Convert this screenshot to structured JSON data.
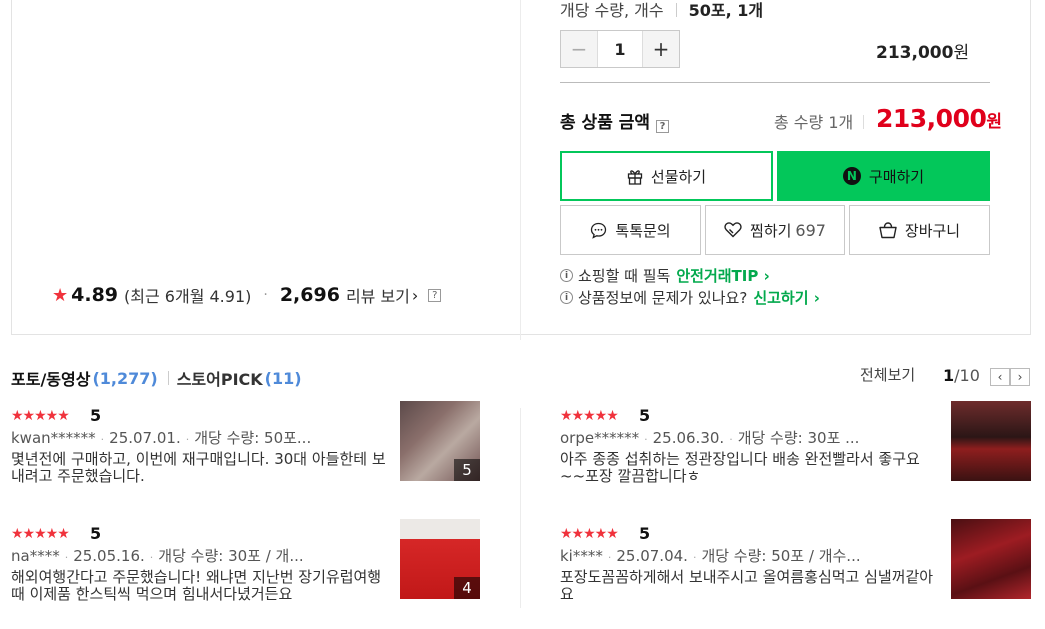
{
  "product_summary": {
    "rating_score": "4.89",
    "rating_recent": "(최근 6개월 4.91)",
    "review_count": "2,696",
    "review_link_label": "리뷰 보기"
  },
  "option": {
    "label": "개당 수량, 개수",
    "value": "50포, 1개",
    "quantity": "1",
    "line_price": "213,000",
    "currency": "원"
  },
  "total": {
    "label": "총 상품 금액",
    "qty_text": "총 수량 1개",
    "price": "213,000",
    "currency": "원"
  },
  "buttons": {
    "gift": "선물하기",
    "buy": "구매하기",
    "npay_mark": "N",
    "talk": "톡톡문의",
    "wish": "찜하기",
    "wish_count": "697",
    "cart": "장바구니"
  },
  "notices": [
    {
      "text": "쇼핑할 때 필독",
      "link": "안전거래TIP ›"
    },
    {
      "text": "상품정보에 문제가 있나요?",
      "link": "신고하기 ›"
    }
  ],
  "photo_reviews": {
    "tab_photo": "포토/동영상",
    "tab_photo_count": "(1,277)",
    "tab_store": "스토어PICK",
    "tab_store_count": "(11)",
    "see_all": "전체보기",
    "page_current": "1",
    "page_total": "/10",
    "items": [
      {
        "stars": "★★★★★",
        "rating": "5",
        "user": "kwan******",
        "date": "25.07.01.",
        "option": "개당 수량: 50포...",
        "body": "몇년전에 구매하고, 이번에 재구매입니다. 30대 아들한테 보내려고 주문했습니다.",
        "photo_count": "5"
      },
      {
        "stars": "★★★★★",
        "rating": "5",
        "user": "orpe******",
        "date": "25.06.30.",
        "option": "개당 수량: 30포 ...",
        "body": "아주 종종 섭취하는 정관장입니다 배송 완전빨라서 좋구요~~포장 깔끔합니다ㅎ",
        "photo_count": ""
      },
      {
        "stars": "★★★★★",
        "rating": "5",
        "user": "na****",
        "date": "25.05.16.",
        "option": "개당 수량: 30포 / 개...",
        "body": "해외여행간다고 주문했습니다! 왜냐면 지난번 장기유럽여행때 이제품 한스틱씩 먹으며 힘내서다녔거든요",
        "photo_count": "4"
      },
      {
        "stars": "★★★★★",
        "rating": "5",
        "user": "ki****",
        "date": "25.07.04.",
        "option": "개당 수량: 50포 / 개수...",
        "body": "포장도꼼꼼하게해서 보내주시고 올여름홍심먹고 심낼꺼같아요",
        "photo_count": ""
      }
    ]
  },
  "colors": {
    "accent_green": "#03c75a",
    "price_red": "#e0001b",
    "star_red": "#f0323c",
    "count_blue": "#4f8ad9"
  }
}
